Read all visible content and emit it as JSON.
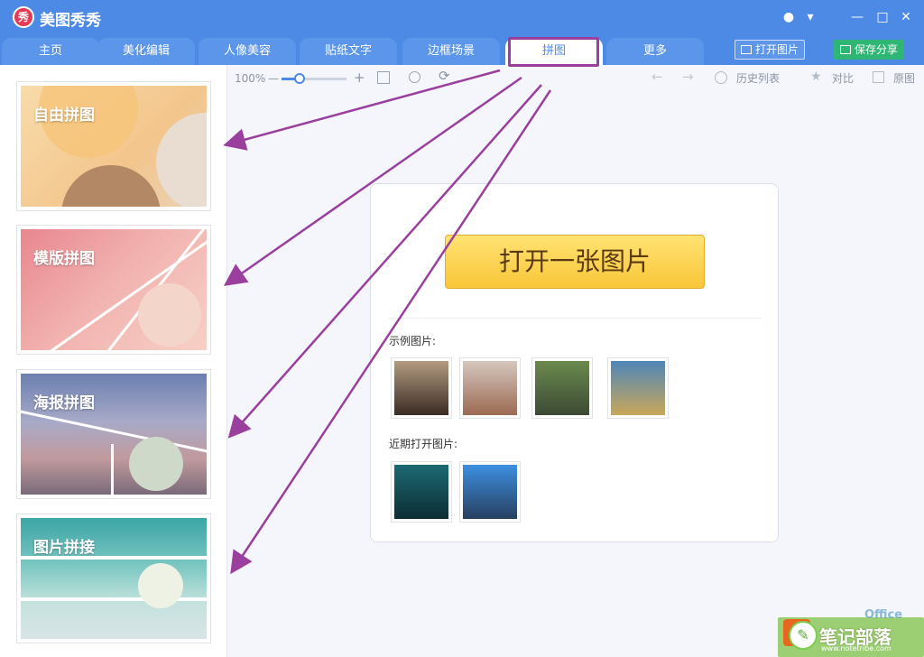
{
  "app": {
    "title": "美图秀秀",
    "logo_char": "秀"
  },
  "window_controls": {
    "chat": "●",
    "menu": "▾",
    "minimize": "—",
    "maximize": "□",
    "close": "✕"
  },
  "nav": {
    "tabs": [
      {
        "label": "主页"
      },
      {
        "label": "美化编辑"
      },
      {
        "label": "人像美容"
      },
      {
        "label": "贴纸文字"
      },
      {
        "label": "边框场景"
      },
      {
        "label": "拼图"
      },
      {
        "label": "更多"
      }
    ],
    "active_tab": "拼图",
    "open_image": "打开图片",
    "save_share": "保存分享"
  },
  "collage_modes": [
    {
      "label": "自由拼图"
    },
    {
      "label": "模版拼图"
    },
    {
      "label": "海报拼图"
    },
    {
      "label": "图片拼接"
    }
  ],
  "toolbar": {
    "zoom": "100%",
    "zoom_level": 0.3,
    "minus": "—",
    "plus": "+",
    "history": "历史列表",
    "compare": "对比",
    "original": "原图"
  },
  "main": {
    "open_one_image": "打开一张图片",
    "sample_images_label": "示例图片:",
    "recent_images_label": "近期打开图片:"
  },
  "sample_images": [
    {
      "name": "woman-portrait-1",
      "color_top": "#b49b80",
      "color_bottom": "#3a2b24"
    },
    {
      "name": "woman-portrait-2",
      "color_top": "#d5c7be",
      "color_bottom": "#9c6a52"
    },
    {
      "name": "child-portrait",
      "color_top": "#6a8a4d",
      "color_bottom": "#3d4a34"
    },
    {
      "name": "seaside-grass",
      "color_top": "#4f86b8",
      "color_bottom": "#c9a75a"
    }
  ],
  "recent_images": [
    {
      "name": "aurora",
      "color_top": "#1d6a74",
      "color_bottom": "#0c2e34"
    },
    {
      "name": "mountain-sky",
      "color_top": "#3d8fe0",
      "color_bottom": "#274060"
    }
  ],
  "watermark": {
    "text": "笔记部落",
    "sub": "www.notetribe.com",
    "extra": "Office"
  },
  "colors": {
    "brand_blue": "#4d8ae6",
    "arrow_purple": "#9b3f9e",
    "save_green": "#2fb574"
  }
}
